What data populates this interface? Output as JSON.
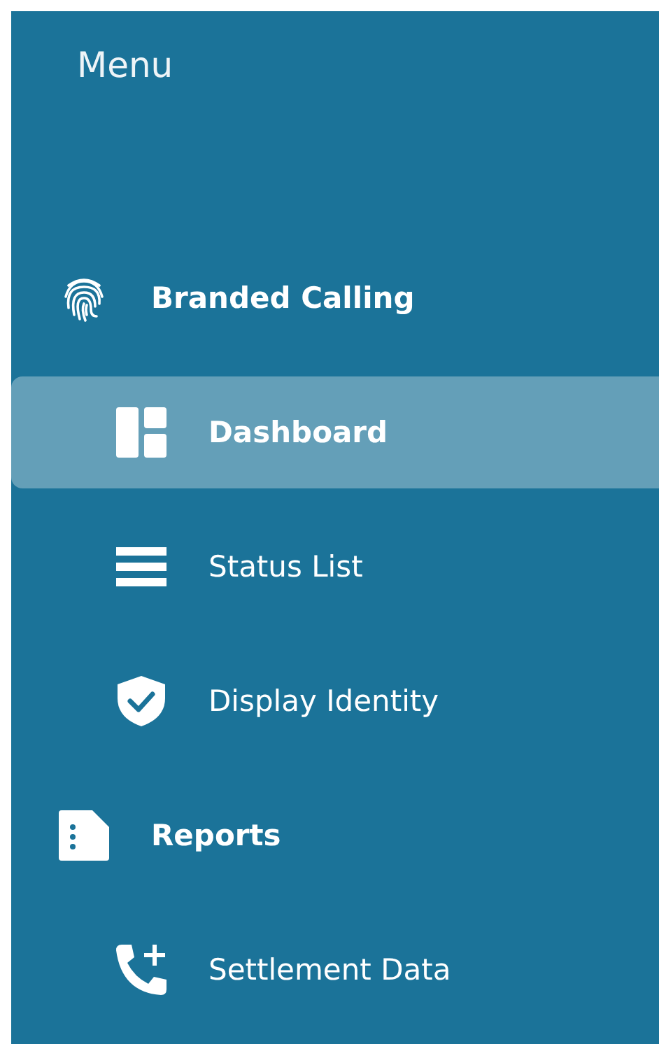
{
  "menu": {
    "title": "Menu"
  },
  "groups": [
    {
      "label": "Branded Calling",
      "children": [
        {
          "label": "Dashboard",
          "selected": true
        },
        {
          "label": "Status List",
          "selected": false
        },
        {
          "label": "Display Identity",
          "selected": false
        }
      ]
    },
    {
      "label": "Reports",
      "children": [
        {
          "label": "Settlement Data",
          "selected": false
        }
      ]
    }
  ]
}
